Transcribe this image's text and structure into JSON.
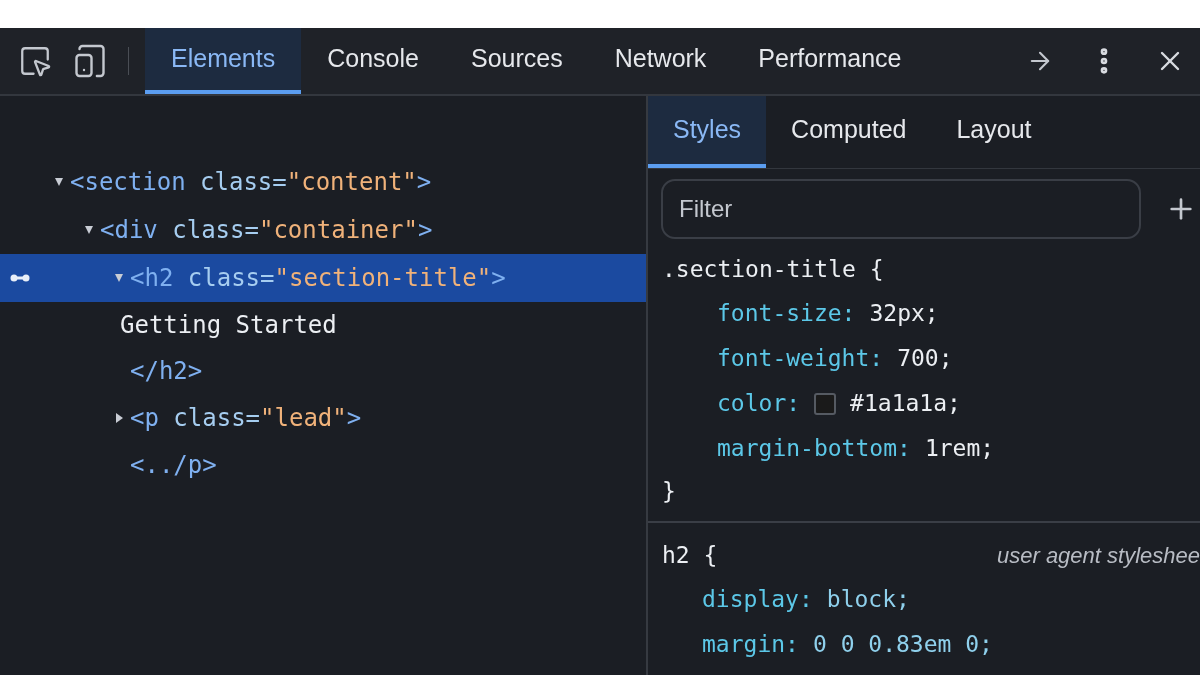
{
  "toolbar": {
    "tabs": [
      {
        "label": "Elements",
        "selected": true
      },
      {
        "label": "Console",
        "selected": false
      },
      {
        "label": "Sources",
        "selected": false
      },
      {
        "label": "Network",
        "selected": false
      },
      {
        "label": "Performance",
        "selected": false
      }
    ]
  },
  "dom_tree": [
    {
      "kind": "tag",
      "open": "<section",
      "attr": "class=",
      "value": "\"content\"",
      "end": ">",
      "expanded": true,
      "selected": false,
      "children": [
        {
          "kind": "tag",
          "open": "<div",
          "attr": "class=",
          "value": "\"container\"",
          "end": ">",
          "expanded": true,
          "selected": false,
          "children": [
            {
              "kind": "tag",
              "open": "<h2",
              "attr": "class=",
              "value": "\"section-title\"",
              "end": ">",
              "expanded": true,
              "selected": true,
              "children": [
                {
                  "kind": "text",
                  "text": "Getting Started"
                }
              ]
            },
            {
              "kind": "close",
              "text": "</h2>"
            },
            {
              "kind": "tag",
              "open": "<p",
              "attr": "class=",
              "value": "\"lead\"",
              "end": ">",
              "expanded": false,
              "selected": false
            },
            {
              "kind": "close",
              "text": "<../p>"
            }
          ]
        }
      ]
    }
  ],
  "styles_pane": {
    "tabs": [
      {
        "label": "Styles",
        "selected": true
      },
      {
        "label": "Computed",
        "selected": false
      },
      {
        "label": "Layout",
        "selected": false
      }
    ],
    "filter": {
      "placeholder": "Filter"
    },
    "rules": [
      {
        "selector_text": ".section-title {",
        "close": "}",
        "declarations": [
          {
            "property": "font-size:",
            "value": "32px;"
          },
          {
            "property": "font-weight:",
            "value": "700;"
          },
          {
            "property": "color:",
            "value": "#1a1a1a;",
            "color": "#1a1a1a"
          },
          {
            "property": "margin-bottom:",
            "value": "1rem;"
          }
        ]
      },
      {
        "selector_text": "h2 {",
        "source": "user agent styleshee",
        "declarations": [
          {
            "property": "display:",
            "value": "block;",
            "kind": "keyword"
          },
          {
            "property": "margin:",
            "value": "0 0 0.83em 0;",
            "kind": "keyword"
          }
        ]
      }
    ]
  }
}
